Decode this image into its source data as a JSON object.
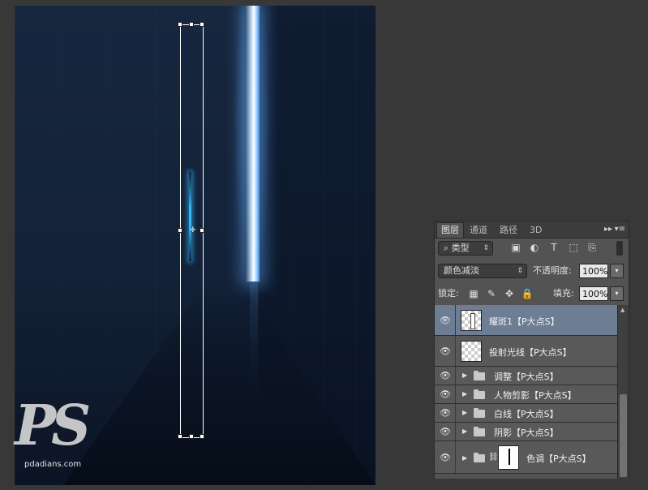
{
  "watermark": {
    "logo_text": "PS",
    "site": "pdadians.com"
  },
  "layers_panel": {
    "tabs": [
      {
        "label": "图层"
      },
      {
        "label": "通道"
      },
      {
        "label": "路径"
      },
      {
        "label": "3D"
      }
    ],
    "filter_kind": "类型",
    "filter_icons": [
      "image-icon",
      "adjustment-icon",
      "text-icon",
      "shape-icon",
      "smart-object-icon"
    ],
    "blend_mode": "颜色减淡",
    "opacity_label": "不透明度:",
    "opacity_value": "100%",
    "lock_label": "锁定:",
    "fill_label": "填充:",
    "fill_value": "100%",
    "layers": [
      {
        "name": "耀斑1【P大点S】",
        "type": "layer",
        "selected": true,
        "visible": true
      },
      {
        "name": "投射光线【P大点S】",
        "type": "layer",
        "selected": false,
        "visible": true
      },
      {
        "name": "调整【P大点S】",
        "type": "group",
        "selected": false,
        "visible": true
      },
      {
        "name": "人物剪影【P大点S】",
        "type": "group",
        "selected": false,
        "visible": true
      },
      {
        "name": "白线【P大点S】",
        "type": "group",
        "selected": false,
        "visible": true
      },
      {
        "name": "阴影【P大点S】",
        "type": "group",
        "selected": false,
        "visible": true
      },
      {
        "name": "色调【P大点S】",
        "type": "group-masked",
        "selected": false,
        "visible": true
      }
    ]
  }
}
